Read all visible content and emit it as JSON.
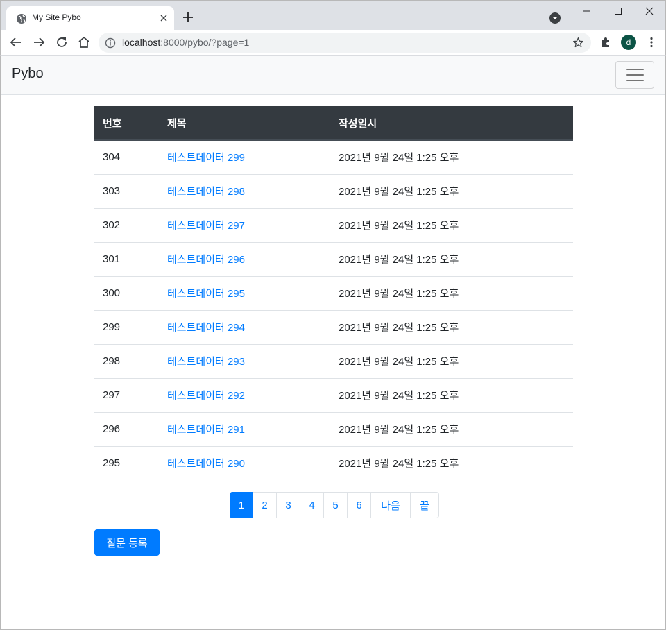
{
  "browser": {
    "tab_title": "My Site Pybo",
    "url_host": "localhost",
    "url_rest": ":8000/pybo/?page=1",
    "profile_initial": "d"
  },
  "navbar": {
    "brand": "Pybo"
  },
  "table": {
    "headers": [
      "번호",
      "제목",
      "작성일시"
    ],
    "rows": [
      {
        "num": "304",
        "subject": "테스트데이터 299",
        "date": "2021년 9월 24일 1:25 오후"
      },
      {
        "num": "303",
        "subject": "테스트데이터 298",
        "date": "2021년 9월 24일 1:25 오후"
      },
      {
        "num": "302",
        "subject": "테스트데이터 297",
        "date": "2021년 9월 24일 1:25 오후"
      },
      {
        "num": "301",
        "subject": "테스트데이터 296",
        "date": "2021년 9월 24일 1:25 오후"
      },
      {
        "num": "300",
        "subject": "테스트데이터 295",
        "date": "2021년 9월 24일 1:25 오후"
      },
      {
        "num": "299",
        "subject": "테스트데이터 294",
        "date": "2021년 9월 24일 1:25 오후"
      },
      {
        "num": "298",
        "subject": "테스트데이터 293",
        "date": "2021년 9월 24일 1:25 오후"
      },
      {
        "num": "297",
        "subject": "테스트데이터 292",
        "date": "2021년 9월 24일 1:25 오후"
      },
      {
        "num": "296",
        "subject": "테스트데이터 291",
        "date": "2021년 9월 24일 1:25 오후"
      },
      {
        "num": "295",
        "subject": "테스트데이터 290",
        "date": "2021년 9월 24일 1:25 오후"
      }
    ]
  },
  "pagination": {
    "items": [
      {
        "label": "1",
        "active": true
      },
      {
        "label": "2",
        "active": false
      },
      {
        "label": "3",
        "active": false
      },
      {
        "label": "4",
        "active": false
      },
      {
        "label": "5",
        "active": false
      },
      {
        "label": "6",
        "active": false
      },
      {
        "label": "다음",
        "active": false
      },
      {
        "label": "끝",
        "active": false
      }
    ]
  },
  "actions": {
    "create_label": "질문 등록"
  },
  "colors": {
    "primary": "#007bff",
    "table_header": "#343a40",
    "navbar_bg": "#f8f9fa"
  },
  "icons": [
    "globe-icon",
    "close-icon",
    "plus-icon",
    "tab-search-icon",
    "minimize-icon",
    "maximize-icon",
    "window-close-icon",
    "back-icon",
    "forward-icon",
    "reload-icon",
    "home-icon",
    "info-icon",
    "star-icon",
    "extensions-icon",
    "menu-icon",
    "hamburger-icon"
  ]
}
